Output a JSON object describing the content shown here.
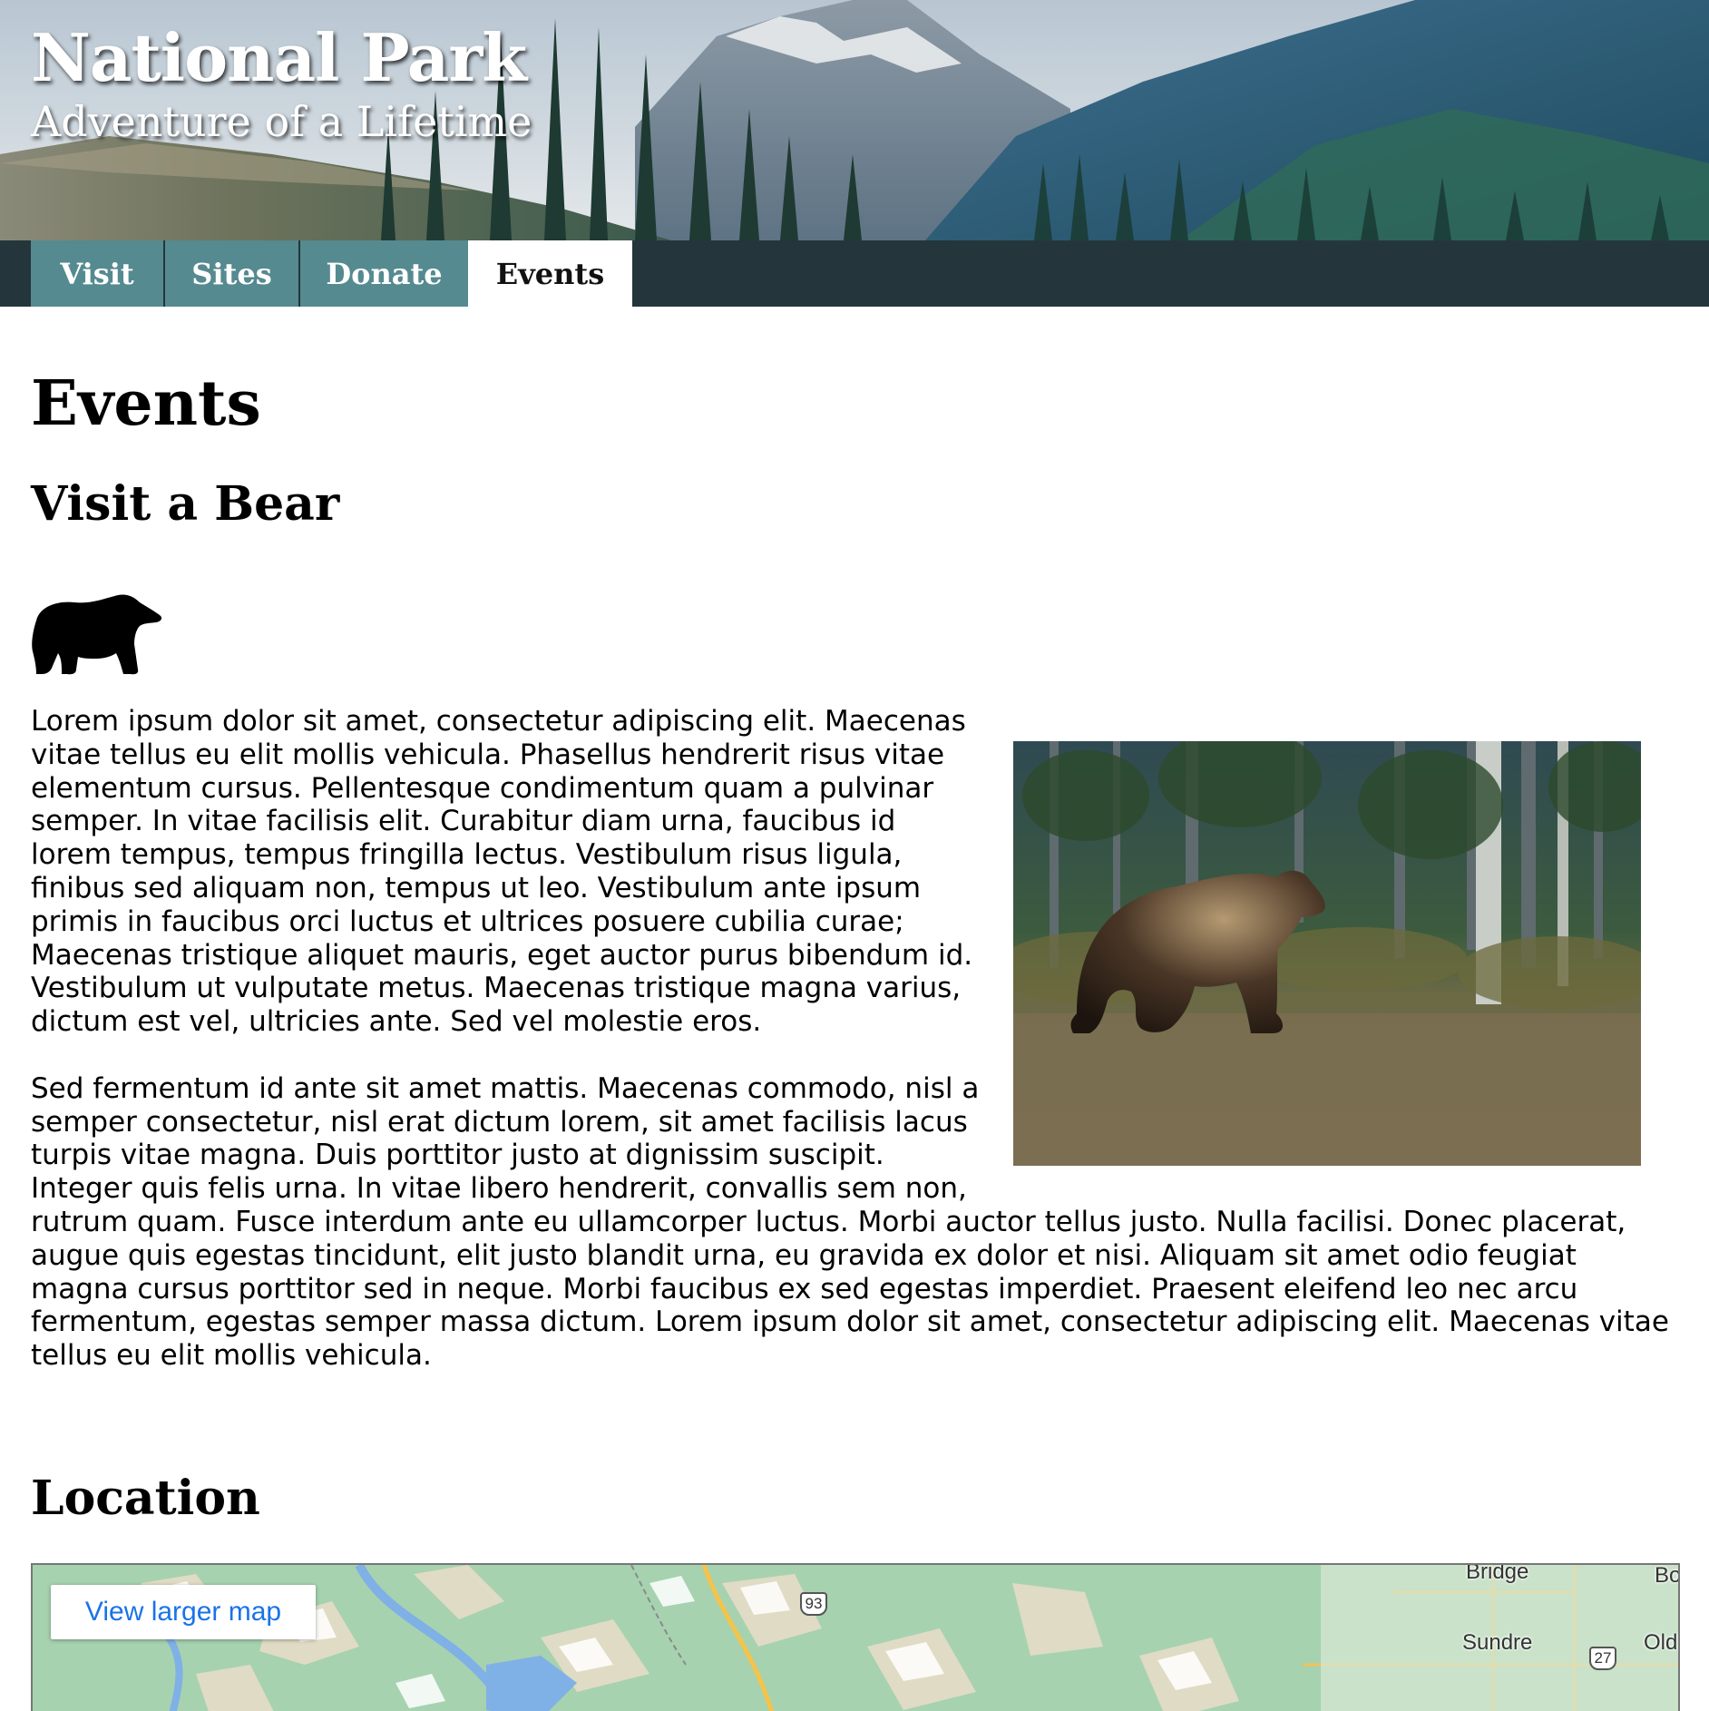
{
  "banner": {
    "title": "National Park",
    "tagline": "Adventure of a Lifetime"
  },
  "nav": {
    "tabs": [
      {
        "label": "Visit",
        "active": false
      },
      {
        "label": "Sites",
        "active": false
      },
      {
        "label": "Donate",
        "active": false
      },
      {
        "label": "Events",
        "active": true
      }
    ]
  },
  "main": {
    "page_title": "Events",
    "event": {
      "title": "Visit a Bear",
      "icon": "bear-silhouette-icon",
      "paragraphs": [
        "Lorem ipsum dolor sit amet, consectetur adipiscing elit. Maecenas vitae tellus eu elit mollis vehicula. Phasellus hendrerit risus vitae elementum cursus. Pellentesque condimentum quam a pulvinar semper. In vitae facilisis elit. Curabitur diam urna, faucibus id lorem tempus, tempus fringilla lectus. Vestibulum risus ligula, finibus sed aliquam non, tempus ut leo. Vestibulum ante ipsum primis in faucibus orci luctus et ultrices posuere cubilia curae; Maecenas tristique aliquet mauris, eget auctor purus bibendum id. Vestibulum ut vulputate metus. Maecenas tristique magna varius, dictum est vel, ultricies ante. Sed vel molestie eros.",
        "Sed fermentum id ante sit amet mattis. Maecenas commodo, nisl a semper consectetur, nisl erat dictum lorem, sit amet facilisis lacus turpis vitae magna. Duis porttitor justo at dignissim suscipit. Integer quis felis urna. In vitae libero hendrerit, convallis sem non, rutrum quam. Fusce interdum ante eu ullamcorper luctus. Morbi auctor tellus justo. Nulla facilisi. Donec placerat, augue quis egestas tincidunt, elit justo blandit urna, eu gravida ex dolor et nisi. Aliquam sit amet odio feugiat magna cursus porttitor sed in neque. Morbi faucibus ex sed egestas imperdiet. Praesent eleifend leo nec arcu fermentum, egestas semper massa dictum. Lorem ipsum dolor sit amet, consectetur adipiscing elit. Maecenas vitae tellus eu elit mollis vehicula."
      ]
    },
    "location": {
      "title": "Location",
      "map": {
        "button_label": "View larger map",
        "labels": [
          "Bridge",
          "Sundre",
          "Old",
          "Bo"
        ],
        "shields": [
          "93",
          "27"
        ]
      }
    }
  },
  "colors": {
    "nav_background": "#24363c",
    "tab_background": "#558a90",
    "tab_active_background": "#ffffff",
    "map_link": "#1a73e8"
  }
}
